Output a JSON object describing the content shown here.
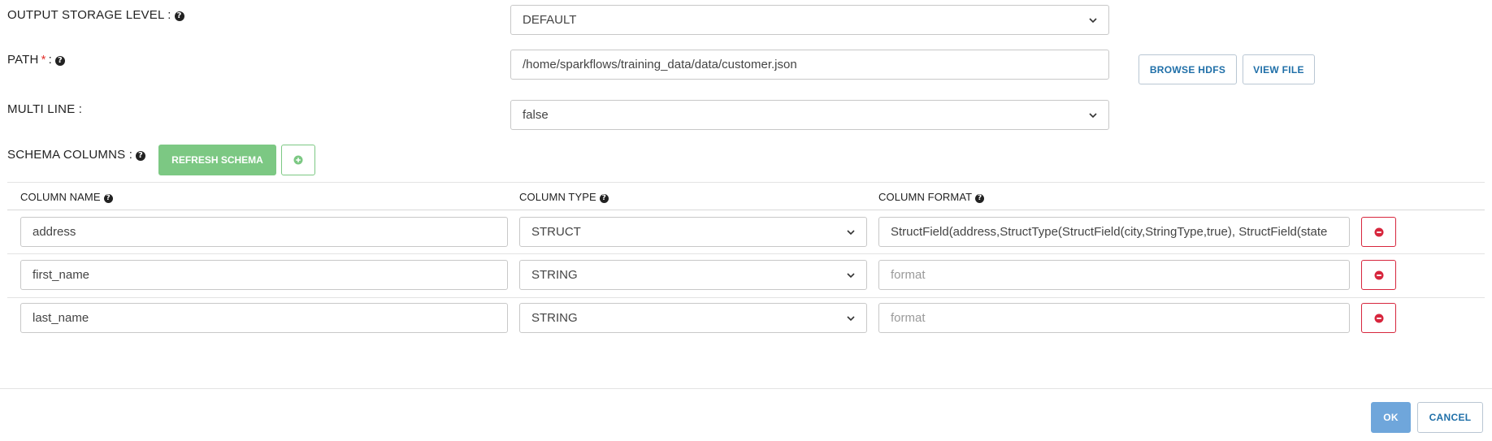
{
  "form": {
    "output_storage_level": {
      "label": "OUTPUT STORAGE LEVEL :",
      "value": "DEFAULT"
    },
    "path": {
      "label": "PATH",
      "required": "*",
      "sep": ":",
      "value": "/home/sparkflows/training_data/data/customer.json"
    },
    "browse_hdfs_label": "BROWSE HDFS",
    "view_file_label": "VIEW FILE",
    "multi_line": {
      "label": "MULTI LINE :",
      "value": "false"
    },
    "schema_columns": {
      "label": "SCHEMA COLUMNS :",
      "refresh_label": "REFRESH SCHEMA"
    }
  },
  "table": {
    "headers": {
      "name": "COLUMN NAME",
      "type": "COLUMN TYPE",
      "format": "COLUMN FORMAT"
    },
    "format_placeholder": "format",
    "rows": [
      {
        "name": "address",
        "type": "STRUCT",
        "format": "StructField(address,StructType(StructField(city,StringType,true), StructField(state"
      },
      {
        "name": "first_name",
        "type": "STRING",
        "format": ""
      },
      {
        "name": "last_name",
        "type": "STRING",
        "format": ""
      }
    ]
  },
  "footer": {
    "ok_label": "OK",
    "cancel_label": "CANCEL"
  },
  "colors": {
    "green": "#7cc883",
    "red": "#d7263d",
    "blue_link": "#1f6fa8",
    "ok_blue": "#6fa6db"
  },
  "icons": {
    "help": "question-circle-icon",
    "chevron": "chevron-down-icon",
    "add": "plus-circle-icon",
    "remove": "minus-circle-icon"
  }
}
